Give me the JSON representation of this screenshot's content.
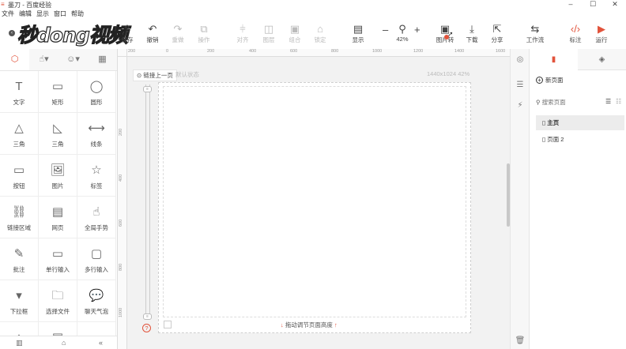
{
  "window": {
    "title": "墨刀 - 百度经验",
    "controls": [
      "–",
      "☐",
      "✕"
    ]
  },
  "watermark": {
    "text": "秒dong视频"
  },
  "menu": [
    "文件",
    "编辑",
    "显示",
    "窗口",
    "帮助"
  ],
  "toolbar": {
    "save": "保存",
    "undo": "撤销",
    "redo": "重做",
    "operate": "操作",
    "align": "对齐",
    "layer": "图层",
    "group": "组合",
    "lock": "锁定",
    "display": "显示",
    "zoom": "42%",
    "image": "图片转",
    "download": "下载",
    "share": "分享",
    "workflow": "工作流",
    "annotate": "标注",
    "run": "运行"
  },
  "left_panel": {
    "widgets": [
      {
        "label": "文字",
        "icon": "T"
      },
      {
        "label": "矩形",
        "icon": "▭"
      },
      {
        "label": "圆形",
        "icon": "◯"
      },
      {
        "label": "三角",
        "icon": "△"
      },
      {
        "label": "三角",
        "icon": "◺"
      },
      {
        "label": "线条",
        "icon": "⟷"
      },
      {
        "label": "按钮",
        "icon": "▭"
      },
      {
        "label": "图片",
        "icon": "🖼"
      },
      {
        "label": "标签",
        "icon": "☆"
      },
      {
        "label": "链接区域",
        "icon": "⛓"
      },
      {
        "label": "网页",
        "icon": "▤"
      },
      {
        "label": "全局手势",
        "icon": "☝"
      },
      {
        "label": "批注",
        "icon": "✎"
      },
      {
        "label": "单行输入",
        "icon": "▭"
      },
      {
        "label": "多行输入",
        "icon": "▢"
      },
      {
        "label": "下拉框",
        "icon": "▾"
      },
      {
        "label": "选择文件",
        "icon": "🗀"
      },
      {
        "label": "聊天气泡",
        "icon": "💬"
      }
    ],
    "collapse": "«"
  },
  "canvas": {
    "ruler_h": [
      "200",
      "0",
      "200",
      "400",
      "600",
      "800",
      "1000",
      "1200",
      "1400",
      "1600"
    ],
    "ruler_v": [
      "200",
      "400",
      "600",
      "800",
      "1000"
    ],
    "link_prev": "链接上一页",
    "state": "默认状态",
    "size": "1440x1024 42%",
    "drag_hint": "拖动调节页面高度"
  },
  "right_panel": {
    "new_page": "新页面",
    "search_placeholder": "搜索页面",
    "pages": [
      "主页",
      "页面 2"
    ]
  }
}
